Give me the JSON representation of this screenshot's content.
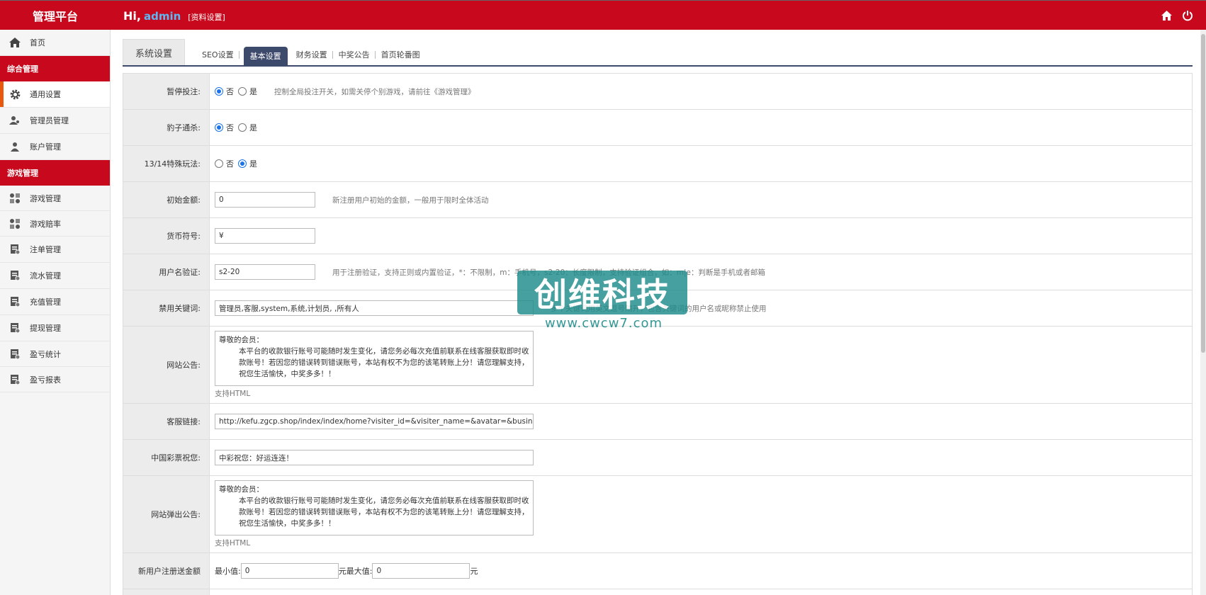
{
  "header": {
    "brand": "管理平台",
    "greeting": "Hi,",
    "username": "admin",
    "profile_link": "[资料设置]"
  },
  "sidebar": {
    "home": "首页",
    "groups": [
      {
        "title": "综合管理",
        "items": [
          {
            "label": "通用设置",
            "icon": "gear-icon",
            "active": true
          },
          {
            "label": "管理员管理",
            "icon": "users-icon"
          },
          {
            "label": "账户管理",
            "icon": "user-icon"
          }
        ]
      },
      {
        "title": "游戏管理",
        "items": [
          {
            "label": "游戏管理",
            "icon": "grid-icon"
          },
          {
            "label": "游戏赔率",
            "icon": "grid-icon"
          },
          {
            "label": "注单管理",
            "icon": "doc-icon"
          },
          {
            "label": "流水管理",
            "icon": "doc-icon"
          },
          {
            "label": "充值管理",
            "icon": "doc-icon"
          },
          {
            "label": "提现管理",
            "icon": "doc-icon"
          },
          {
            "label": "盈亏统计",
            "icon": "doc-icon"
          },
          {
            "label": "盈亏报表",
            "icon": "doc-icon"
          }
        ]
      }
    ]
  },
  "tabs": {
    "primary": "系统设置",
    "sub": [
      "SEO设置",
      "基本设置",
      "财务设置",
      "中奖公告",
      "首页轮番图"
    ],
    "active_sub": "基本设置"
  },
  "form": {
    "pause_bet": {
      "label": "暂停投注:",
      "opt_no": "否",
      "opt_yes": "是",
      "selected": "否",
      "hint": "控制全局投注开关，如需关停个别游戏，请前往《游戏管理》"
    },
    "leopard_kill": {
      "label": "豹子通杀:",
      "opt_no": "否",
      "opt_yes": "是",
      "selected": "否"
    },
    "special_1314": {
      "label": "13/14特殊玩法:",
      "opt_no": "否",
      "opt_yes": "是",
      "selected": "是"
    },
    "initial_amount": {
      "label": "初始金额:",
      "value": "0",
      "hint": "新注册用户初始的金额，一般用于限时全体活动"
    },
    "currency": {
      "label": "货币符号:",
      "value": "¥"
    },
    "username_rule": {
      "label": "用户名验证:",
      "value": "s2-20",
      "hint": "用于注册验证，支持正则或内置验证，*：不限制，m：手机号，s2-20：长度限制，支持验证组合，如：m|e：判断是手机或者邮箱"
    },
    "banned_keywords": {
      "label": "禁用关键词:",
      "value": "管理员,客服,system,系统,计划员, ,所有人",
      "hint": "多个关键词用英文逗号隔开，包含关键词的用户名或昵称禁止使用"
    },
    "site_notice": {
      "label": "网站公告:",
      "line1": "尊敬的会员：",
      "line2": "本平台的收款银行账号可能随时发生变化，请您务必每次充值前联系在线客服获取即时收款账号！若因您的错误转到错误账号，本站有权不为您的该笔转账上分！请您理解支持，祝您生活愉快，中奖多多！！",
      "support": "支持HTML"
    },
    "service_link": {
      "label": "客服链接:",
      "value": "http://kefu.zgcp.shop/index/index/home?visiter_id=&visiter_name=&avatar=&business"
    },
    "lottery_wish": {
      "label": "中国彩票祝您:",
      "value": "中彩祝您：好运连连！"
    },
    "popup_notice": {
      "label": "网站弹出公告:",
      "line1": "尊敬的会员：",
      "line2": "本平台的收款银行账号可能随时发生变化，请您务必每次充值前联系在线客服获取即时收款账号！若因您的错误转到错误账号，本站有权不为您的该笔转账上分！请您理解支持，祝您生活愉快，中奖多多！！",
      "support": "支持HTML"
    },
    "new_user_bonus": {
      "label": "新用户注册送金额",
      "min_label": "最小值:",
      "min_value": "0",
      "max_label": "元最大值:",
      "max_value": "0",
      "unit": "元"
    }
  },
  "watermark": {
    "title": "创维科技",
    "url": "www.cwcw7.com"
  },
  "colors": {
    "header": "#c8081c",
    "tab_active": "#3d4a6b",
    "accent": "#e8580d",
    "link": "#5ab8f5"
  }
}
